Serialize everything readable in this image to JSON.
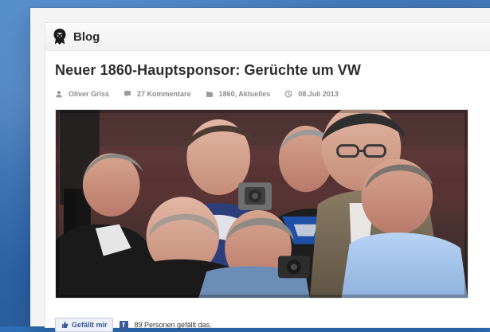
{
  "blog": {
    "title": "Blog",
    "icon": "lion-icon"
  },
  "post": {
    "title": "Neuer 1860-Hauptsponsor: Gerüchte um VW",
    "meta": {
      "author": "Oliver Griss",
      "comments": "27 Kommentare",
      "categories": "1860, Aktuelles",
      "date": "08.Juli 2013"
    }
  },
  "social": {
    "like_label": "Gefällt mir",
    "like_count_text": "89 Personen gefällt das."
  },
  "colors": {
    "background": "#2f6fb8",
    "facebook": "#3b5998"
  }
}
